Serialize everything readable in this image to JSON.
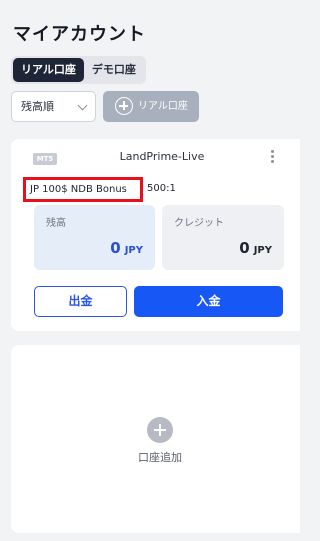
{
  "header": {
    "title": "マイアカウント"
  },
  "tabs": [
    {
      "label": "リアル口座",
      "active": true
    },
    {
      "label": "デモ口座",
      "active": false
    }
  ],
  "toolbar": {
    "sort_value": "残高順",
    "add_real_label": "リアル口座"
  },
  "account": {
    "platform": "MT5",
    "server": "LandPrime-Live",
    "type": "JP 100$ NDB Bonus",
    "leverage": "500:1",
    "balance_label": "残高",
    "balance_value": "0",
    "balance_currency": "JPY",
    "credit_label": "クレジット",
    "credit_value": "0",
    "credit_currency": "JPY",
    "withdraw_label": "出金",
    "deposit_label": "入金"
  },
  "add_account": {
    "label": "口座追加"
  },
  "colors": {
    "primary": "#1757f5",
    "highlight_border": "#e8101a",
    "tab_active": "#1e2536"
  }
}
